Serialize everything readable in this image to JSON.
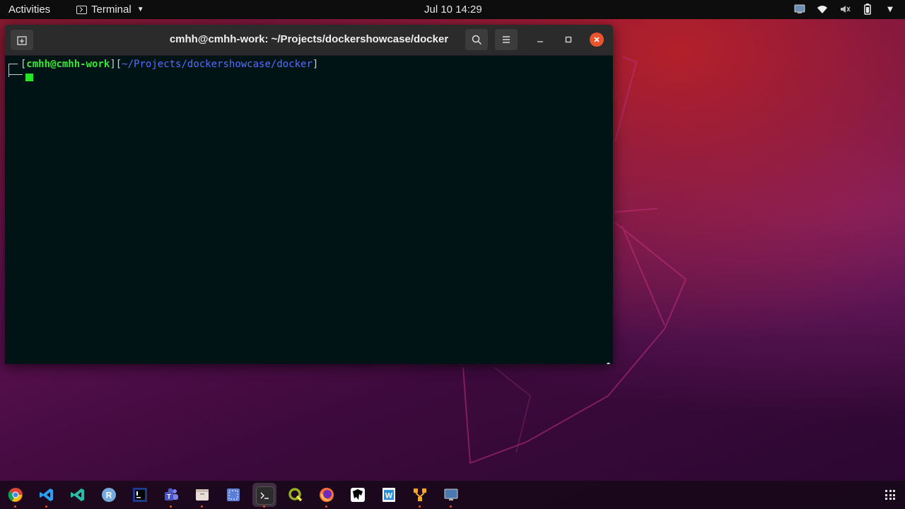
{
  "topbar": {
    "activities": "Activities",
    "app_name": "Terminal",
    "clock": "Jul 10  14:29"
  },
  "window": {
    "title": "cmhh@cmhh-work: ~/Projects/dockershowcase/docker",
    "prompt": {
      "user_host": "cmhh@cmhh-work",
      "path": "~/Projects/dockershowcase/docker"
    }
  },
  "dock": {
    "items": [
      "chrome-icon",
      "vscode-icon",
      "vscode-insiders-icon",
      "r-icon",
      "intellij-icon",
      "teams-icon",
      "files-icon",
      "screenshot-icon",
      "terminal-icon",
      "qgis-icon",
      "firefox-icon",
      "inkscape-icon",
      "libreoffice-writer-icon",
      "yed-icon",
      "remmina-icon"
    ]
  },
  "colors": {
    "terminal_bg": "#011415",
    "prompt_user": "#37e837",
    "prompt_path": "#4f6fff",
    "cursor": "#22e822",
    "close_button": "#e9542f"
  }
}
